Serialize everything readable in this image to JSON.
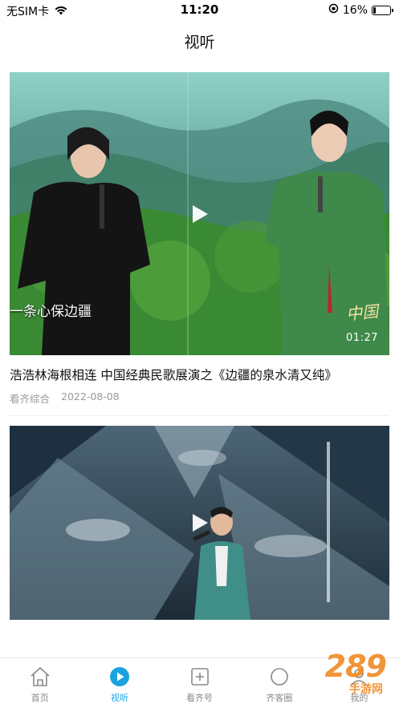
{
  "status_bar": {
    "carrier": "无SIM卡",
    "time": "11:20",
    "battery_percent": "16%",
    "battery_level": 0.16
  },
  "page": {
    "title": "视听"
  },
  "videos": [
    {
      "title": "浩浩林海根相连  中国经典民歌展演之《边疆的泉水清又纯》",
      "source": "看齐综合",
      "date": "2022-08-08",
      "duration": "01:27",
      "overlay_caption": "一条心保边疆",
      "overlay_logo": "中国"
    },
    {
      "title": "",
      "source": "",
      "date": "",
      "duration": ""
    }
  ],
  "tabs": [
    {
      "label": "首页",
      "icon": "home-icon"
    },
    {
      "label": "视听",
      "icon": "play-circle-icon",
      "active": true
    },
    {
      "label": "看齐号",
      "icon": "add-box-icon"
    },
    {
      "label": "齐客圈",
      "icon": "circle-icon"
    },
    {
      "label": "我的",
      "icon": "user-icon"
    }
  ],
  "watermark": {
    "text": "289",
    "sub": "手游网"
  },
  "colors": {
    "accent": "#1aa3e0",
    "tab_inactive": "#8a8a8a",
    "watermark": "#f08a24"
  }
}
